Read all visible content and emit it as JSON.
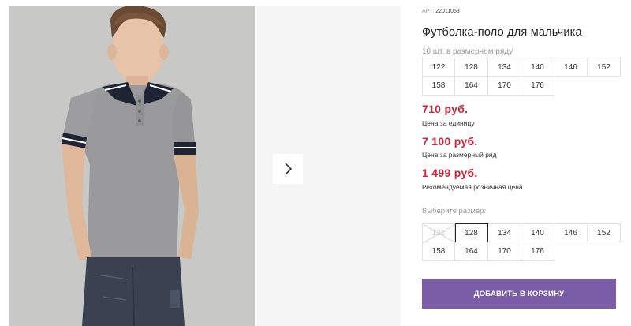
{
  "gallery": {
    "photo_alt": "product-photo-boy-in-grey-polo",
    "next_icon": "chevron-right-icon"
  },
  "product": {
    "article_label": "АРТ:",
    "article_code": "22011063",
    "title": "Футболка-поло для мальчика",
    "sizes_count_text": "10 шт. в размерном ряду",
    "size_range": [
      "122",
      "128",
      "134",
      "140",
      "146",
      "152",
      "158",
      "164",
      "170",
      "176"
    ]
  },
  "prices": {
    "unit_price": "710 руб.",
    "unit_label": "Цена за единицу",
    "set_price": "7 100 руб.",
    "set_label": "Цена за размерный ряд",
    "retail_price": "1 499 руб.",
    "retail_label": "Рекомендуемая розничная цена"
  },
  "size_select": {
    "label": "Выберите размер:",
    "options": [
      "122",
      "128",
      "134",
      "140",
      "146",
      "152",
      "158",
      "164",
      "170",
      "176"
    ],
    "selected": "128",
    "unavailable": [
      "122"
    ]
  },
  "cart": {
    "add_label": "ДОБАВИТЬ В КОРЗИНУ"
  },
  "colors": {
    "price": "#d2233a",
    "accent": "#7b5ca6",
    "photo_bg": "#c9c9c7"
  }
}
